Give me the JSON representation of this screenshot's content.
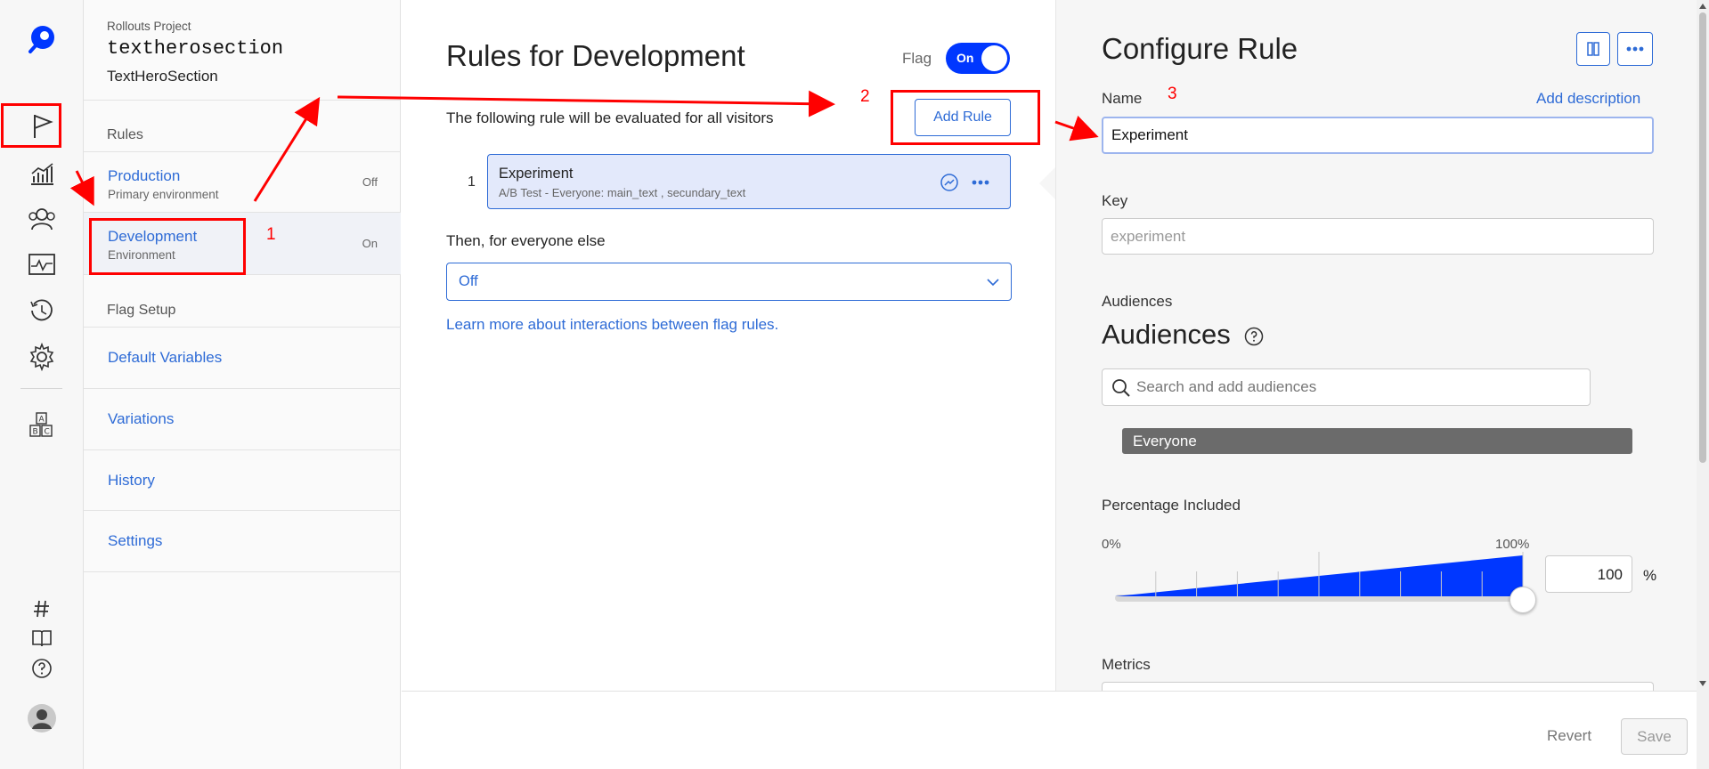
{
  "nav": {
    "project_label": "Rollouts Project",
    "flag_key": "textherosection",
    "flag_name": "TextHeroSection",
    "rules_section": "Rules",
    "environments": [
      {
        "name": "Production",
        "subtitle": "Primary environment",
        "status": "Off"
      },
      {
        "name": "Development",
        "subtitle": "Environment",
        "status": "On"
      }
    ],
    "setup_section": "Flag Setup",
    "setup_items": [
      "Default Variables",
      "Variations",
      "History",
      "Settings"
    ]
  },
  "main": {
    "title": "Rules for Development",
    "flag_label": "Flag",
    "flag_toggle": "On",
    "description": "The following rule will be evaluated for all visitors",
    "add_rule_label": "Add Rule",
    "rule": {
      "index": "1",
      "name": "Experiment",
      "subtitle": "A/B Test - Everyone: main_text , secundary_text"
    },
    "else_label": "Then, for everyone else",
    "else_value": "Off",
    "learn_more": "Learn more about interactions between flag rules."
  },
  "panel": {
    "title": "Configure Rule",
    "name_label": "Name",
    "add_description": "Add description",
    "name_value": "Experiment",
    "key_label": "Key",
    "key_placeholder": "experiment",
    "audiences_label": "Audiences",
    "audiences_heading": "Audiences",
    "search_placeholder": "Search and add audiences",
    "audience_chip": "Everyone",
    "percentage_label": "Percentage Included",
    "range_min": "0%",
    "range_max": "100%",
    "percentage_value": "100",
    "percent_sign": "%",
    "percentage_fraction": 1.0,
    "metrics_label": "Metrics"
  },
  "footer": {
    "revert": "Revert",
    "save": "Save"
  },
  "annotations": {
    "n1": "1",
    "n2": "2",
    "n3": "3"
  },
  "colors": {
    "accent": "#0037ff",
    "link": "#2e6bd6",
    "annotation": "#ff0000",
    "chip": "#6b6b6b"
  }
}
